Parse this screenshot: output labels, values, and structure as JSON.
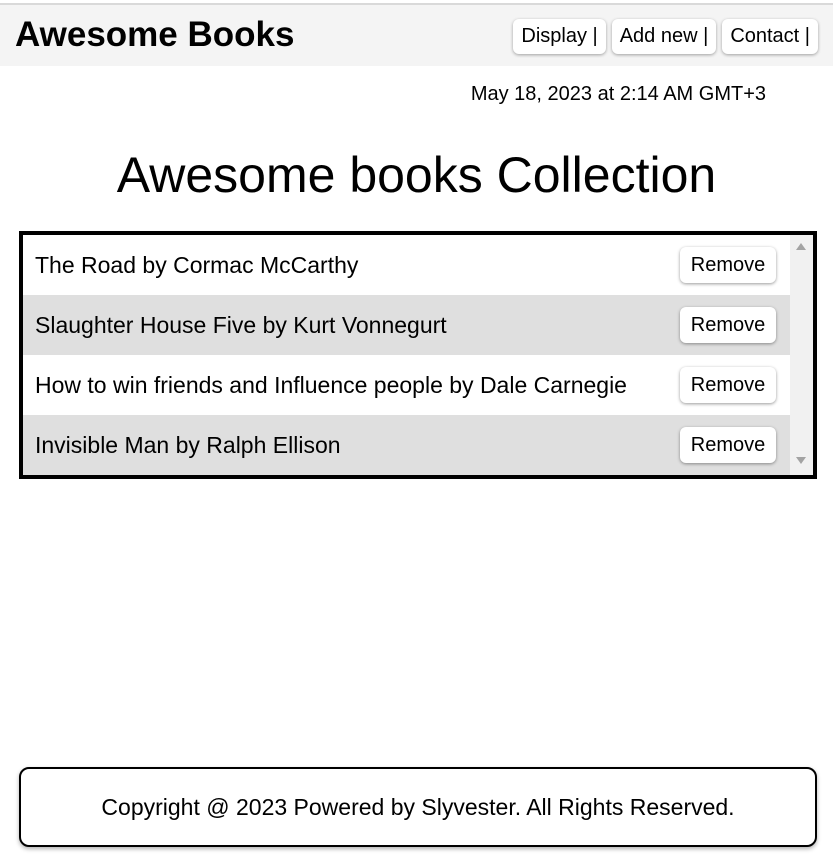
{
  "header": {
    "brand": "Awesome Books",
    "nav": [
      {
        "label": "Display |"
      },
      {
        "label": "Add new |"
      },
      {
        "label": "Contact |"
      }
    ]
  },
  "date_text": "May 18, 2023 at 2:14 AM GMT+3",
  "main": {
    "title": "Awesome books Collection",
    "books": [
      {
        "text": "The Road by Cormac McCarthy",
        "button": "Remove"
      },
      {
        "text": "Slaughter House Five by Kurt Vonnegurt",
        "button": "Remove"
      },
      {
        "text": "How to win friends and Influence people by Dale Carnegie",
        "button": "Remove"
      },
      {
        "text": "Invisible Man by Ralph Ellison",
        "button": "Remove"
      }
    ]
  },
  "footer": {
    "text": "Copyright @ 2023 Powered by Slyvester. All Rights Reserved."
  },
  "colors": {
    "nav_background": "#f4f4f4",
    "row_alt": "#dfdfdf",
    "border": "#000000"
  }
}
